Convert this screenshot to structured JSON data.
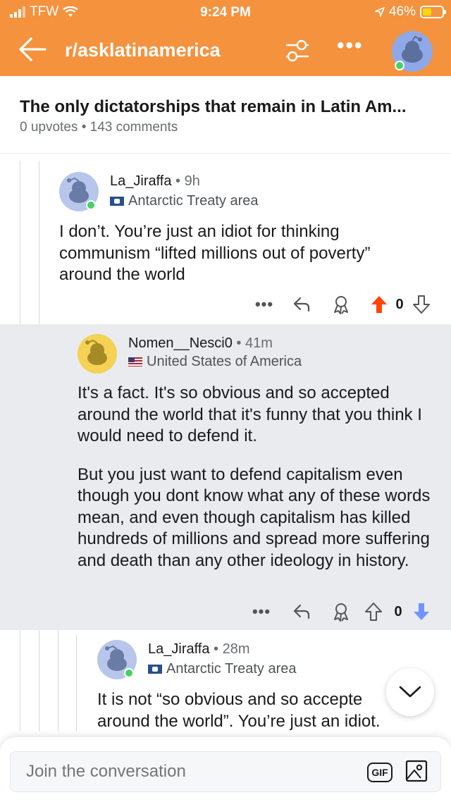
{
  "status_bar": {
    "carrier": "TFW",
    "time": "9:24 PM",
    "battery": "46%"
  },
  "header": {
    "subreddit": "r/asklatinamerica",
    "more": "•••"
  },
  "post": {
    "title": "The only dictatorships that remain in Latin Am...",
    "upvotes": "0 upvotes",
    "separator": "•",
    "comments": "143 comments"
  },
  "comments": [
    {
      "user": "La_Jiraffa",
      "sep": "•",
      "age": "9h",
      "flair": "Antarctic Treaty area",
      "flag": "aq",
      "body": [
        "I don’t. You’re just an idiot for thinking communism “lifted millions out of poverty” around the world"
      ],
      "score": "0",
      "vote": "upvoted",
      "more": "•••"
    },
    {
      "user": "Nomen__Nesci0",
      "sep": "•",
      "age": "41m",
      "flair": "United States of America",
      "flag": "us",
      "body": [
        "It's a fact. It's so obvious and so accepted around the world that it's funny that you think I would need to defend it.",
        "But you just want to defend capitalism even though you dont know what any of these words mean, and even though capitalism has killed hundreds of millions and spread more suffering and death than any other ideology in history."
      ],
      "score": "0",
      "vote": "downvoted",
      "more": "•••"
    },
    {
      "user": "La_Jiraffa",
      "sep": "•",
      "age": "28m",
      "flair": "Antarctic Treaty area",
      "flag": "aq",
      "body": [
        "It is not “so obvious and so accepte",
        "around the world”. You’re just an idiot."
      ]
    }
  ],
  "composer": {
    "placeholder": "Join the conversation",
    "gif_label": "GIF"
  },
  "colors": {
    "header": "#f4923e",
    "upvote": "#ff4500",
    "downvote": "#7193ff",
    "highlight_bg": "#e9ebee"
  },
  "icons": [
    "back-arrow-icon",
    "filter-icon",
    "more-icon",
    "reply-icon",
    "award-icon",
    "upvote-icon",
    "downvote-icon",
    "chevron-down-icon",
    "image-icon"
  ]
}
